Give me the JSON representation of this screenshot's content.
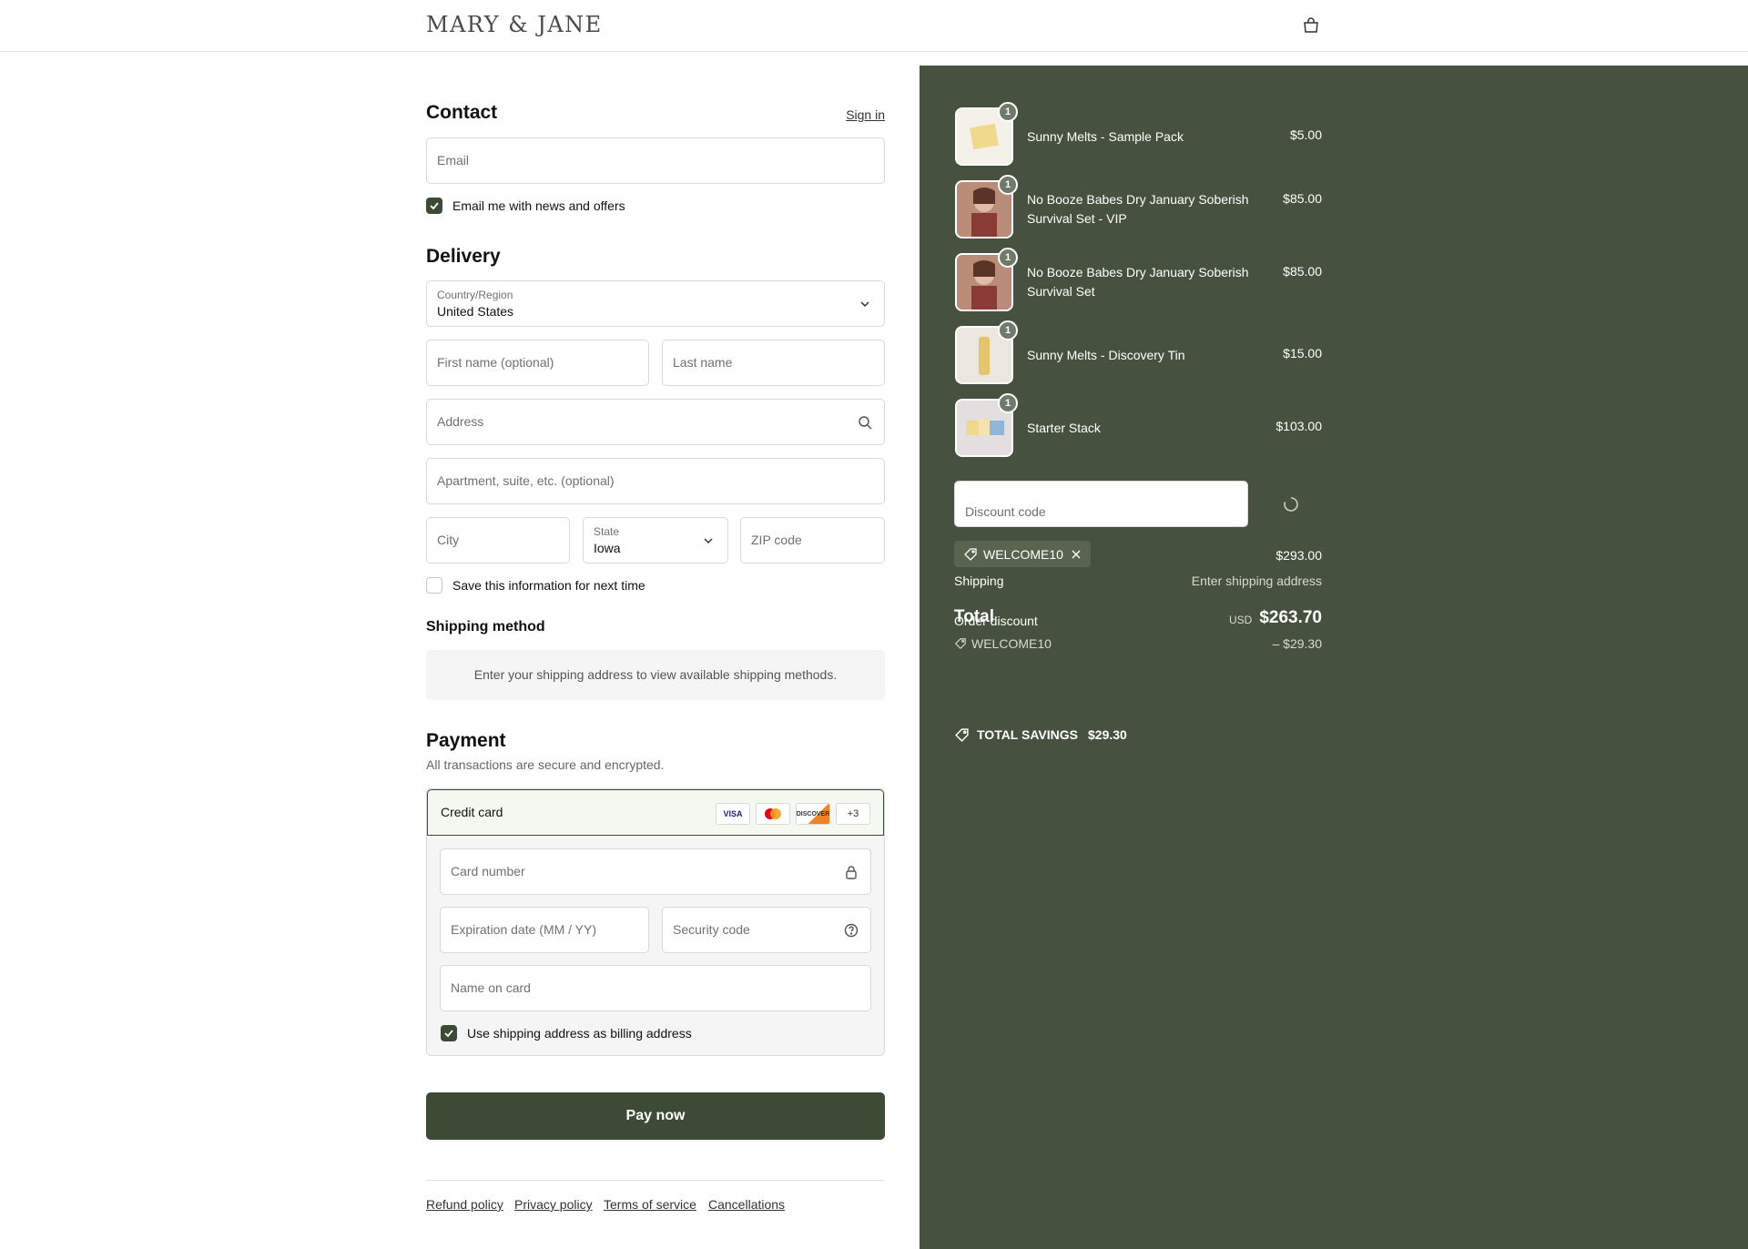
{
  "header": {
    "logo": "MARY & JANE",
    "cart_icon": "bag-icon"
  },
  "contact": {
    "title": "Contact",
    "sign_in": "Sign in",
    "email_placeholder": "Email",
    "newsletter_label": "Email me with news and offers",
    "newsletter_checked": true
  },
  "delivery": {
    "title": "Delivery",
    "country_label": "Country/Region",
    "country_value": "United States",
    "first_name_placeholder": "First name (optional)",
    "last_name_placeholder": "Last name",
    "address_placeholder": "Address",
    "apartment_placeholder": "Apartment, suite, etc. (optional)",
    "city_placeholder": "City",
    "state_label": "State",
    "state_value": "Iowa",
    "zip_placeholder": "ZIP code",
    "save_info_label": "Save this information for next time",
    "save_info_checked": false
  },
  "shipping": {
    "title": "Shipping method",
    "message": "Enter your shipping address to view available shipping methods."
  },
  "payment": {
    "title": "Payment",
    "subtitle": "All transactions are secure and encrypted.",
    "method": "Credit card",
    "card_brands": [
      "VISA",
      "MC",
      "DISCOVER",
      "+3"
    ],
    "card_number_placeholder": "Card number",
    "expiration_placeholder": "Expiration date (MM / YY)",
    "security_placeholder": "Security code",
    "name_placeholder": "Name on card",
    "billing_label": "Use shipping address as billing address",
    "billing_checked": true,
    "pay_button": "Pay now"
  },
  "footer": {
    "links": [
      "Refund policy",
      "Privacy policy",
      "Terms of service",
      "Cancellations"
    ]
  },
  "summary": {
    "items": [
      {
        "name": "Sunny Melts - Sample Pack",
        "qty": "1",
        "price": "$5.00"
      },
      {
        "name": "No Booze Babes Dry January Soberish Survival Set - VIP",
        "qty": "1",
        "price": "$85.00"
      },
      {
        "name": "No Booze Babes Dry January Soberish Survival Set",
        "qty": "1",
        "price": "$85.00"
      },
      {
        "name": "Sunny Melts - Discovery Tin",
        "qty": "1",
        "price": "$15.00"
      },
      {
        "name": "Starter Stack",
        "qty": "1",
        "price": "$103.00"
      }
    ],
    "discount_placeholder": "Discount code",
    "applied_code": "WELCOME10",
    "subtotal_value": "$293.00",
    "shipping_label": "Shipping",
    "shipping_value": "Enter shipping address",
    "total_label": "Total",
    "order_discount_label": "Order discount",
    "currency": "USD",
    "total_value": "$263.70",
    "discount_code_line": "WELCOME10",
    "discount_value": "– $29.30",
    "savings_label": "TOTAL SAVINGS",
    "savings_value": "$29.30"
  },
  "colors": {
    "accent": "#3d4a36",
    "panel": "#46523f"
  }
}
